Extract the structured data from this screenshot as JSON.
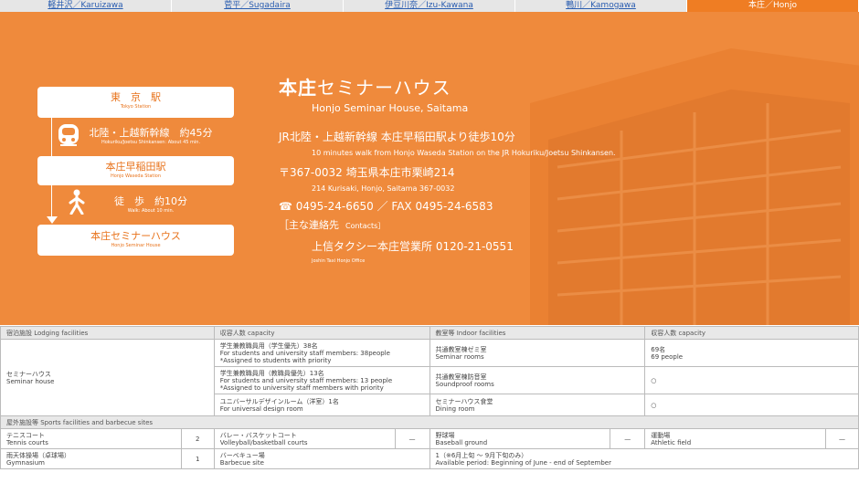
{
  "tabs": [
    {
      "label": "軽井沢／Karuizawa",
      "active": false
    },
    {
      "label": "菅平／Sugadaira",
      "active": false
    },
    {
      "label": "伊豆川奈／Izu-Kawana",
      "active": false
    },
    {
      "label": "鴨川／Kamogawa",
      "active": false
    },
    {
      "label": "本庄／Honjo",
      "active": true
    }
  ],
  "route": {
    "start_jp": "東　京　駅",
    "start_en": "Tokyo Station",
    "train_jp": "北陸・上越新幹線　約45分",
    "train_en": "Hokuriku/Joetsu Shinkansen: About 45 min.",
    "mid_jp": "本庄早稲田駅",
    "mid_en": "Honjo Waseda Station",
    "walk_jp": "徒　歩　約10分",
    "walk_en": "Walk: About 10 min.",
    "end_jp": "本庄セミナーハウス",
    "end_en": "Honjo Seminar House"
  },
  "info": {
    "title_bold": "本庄",
    "title_rest": "セミナーハウス",
    "subtitle": "Honjo Seminar House, Saitama",
    "access_jp": "JR北陸・上越新幹線 本庄早稲田駅より徒歩10分",
    "access_en": "10 minutes walk from Honjo Waseda Station on the JR Hokuriku/Joetsu Shinkansen.",
    "address_jp": "〒367-0032 埼玉県本庄市栗崎214",
    "address_en": "214 Kurisaki, Honjo, Saitama 367-0032",
    "tel": "☎ 0495-24-6650 ／ FAX 0495-24-6583",
    "contacts_jp": "［主な連絡先",
    "contacts_en": "Contacts］",
    "office_jp": "上信タクシー本庄営業所 0120-21-0551",
    "office_en": "Joshin Taxi Honjo Office"
  },
  "table": {
    "h_lodging": "宿泊施設 Lodging facilities",
    "h_capacity": "収容人数 capacity",
    "h_indoor": "教室等 Indoor facilities",
    "h_capacity2": "収容人数 capacity",
    "lodging_name_jp": "セミナーハウス",
    "lodging_name_en": "Seminar house",
    "rows": [
      {
        "cap_l1": "学生兼教職員用（学生優先）38名",
        "cap_l2": "For students and university staff members: 38people",
        "cap_l3": "*Assigned to students with priority",
        "room_l1": "共通教室棟ゼミ室",
        "room_l2": "Seminar rooms",
        "rc_l1": "69名",
        "rc_l2": "69 people"
      },
      {
        "cap_l1": "学生兼教職員用（教職員優先）13名",
        "cap_l2": "For students and university staff members: 13 people",
        "cap_l3": "*Assigned to university staff members with priority",
        "room_l1": "共通教室棟防音室",
        "room_l2": "Soundproof rooms",
        "rc_l1": "○",
        "rc_l2": ""
      },
      {
        "cap_l1": "ユニバーサルデザインルーム（洋室）1名",
        "cap_l2": "For universal design room",
        "cap_l3": "",
        "room_l1": "セミナーハウス食堂",
        "room_l2": "Dining room",
        "rc_l1": "○",
        "rc_l2": ""
      }
    ],
    "h_outdoor": "屋外施設等 Sports facilities and barbecue sites",
    "tennis_jp": "テニスコート",
    "tennis_en": "Tennis courts",
    "tennis_val": "2",
    "volley_jp": "バレー・バスケットコート",
    "volley_en": "Volleyball/basketball courts",
    "volley_val": "—",
    "baseball_jp": "野球場",
    "baseball_en": "Baseball ground",
    "baseball_val": "—",
    "athletic_jp": "運動場",
    "athletic_en": "Athletic field",
    "athletic_val": "—",
    "gym_jp": "雨天体操場（卓球場）",
    "gym_en": "Gymnasium",
    "gym_val": "1",
    "bbq_jp": "バーベキュー場",
    "bbq_en": "Barbecue site",
    "bbq_val_l1": "1（※6月上旬 ～ 9月下旬のみ）",
    "bbq_val_l2": "Available period: Beginning of June - end of September"
  },
  "colors": {
    "accent": "#ef7d23",
    "hero_bg": "#ef8a3c",
    "link": "#2a5db0"
  }
}
